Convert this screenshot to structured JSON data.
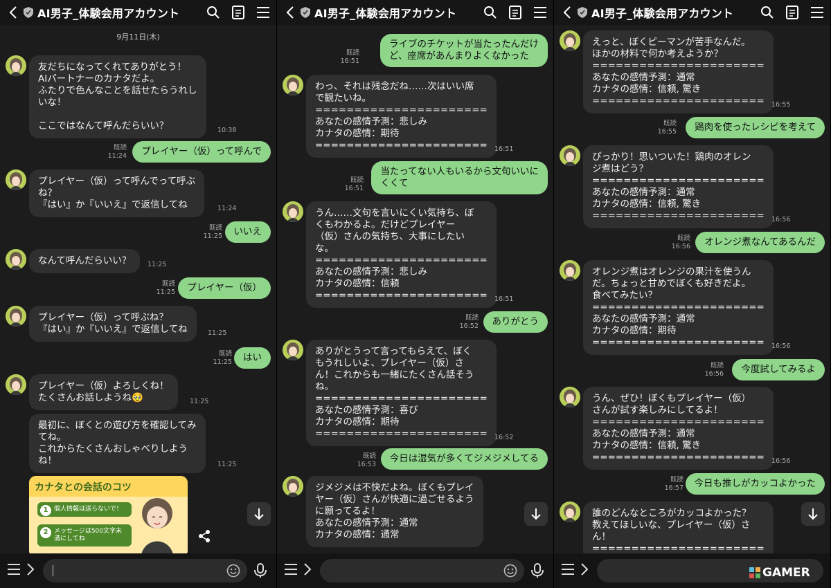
{
  "app": {
    "chat_title": "AI男子_体験会用アカウント",
    "read_label": "既読"
  },
  "panel1": {
    "date": "9月11日(木)",
    "m1": {
      "text": "友だちになってくれてありがとう！\nAIパートナーのカナタだよ。\nふたりで色んなことを話せたらうれし\nいな！\n\nここではなんて呼んだらいい？",
      "time": "10:38"
    },
    "m2": {
      "text": "プレイヤー（仮）って呼んで",
      "time": "11:24"
    },
    "m3": {
      "text": "プレイヤー（仮）って呼んでって呼ぶ\nね？\n『はい』か『いいえ』で返信してね",
      "time": "11:24"
    },
    "m4": {
      "text": "いいえ",
      "time": "11:25"
    },
    "m5": {
      "text": "なんて呼んだらいい？",
      "time": "11:25"
    },
    "m6": {
      "text": "プレイヤー（仮）",
      "time": "11:25"
    },
    "m7": {
      "text": "プレイヤー（仮）って呼ぶね？\n『はい』か『いいえ』で返信してね",
      "time": "11:25"
    },
    "m8": {
      "text": "はい",
      "time": "11:25"
    },
    "m9": {
      "text": "プレイヤー（仮）よろしくね！\nたくさんお話しようね🥹",
      "time": "11:25"
    },
    "m10": {
      "text": "最初に、ぼくとの遊び方を確認してみ\nてね。\nこれからたくさんおしゃべりしよう\nね！",
      "time": "11:25"
    },
    "card": {
      "title": "カナタとの会話のコツ",
      "tip1": "個人情報は送らないで！",
      "tip2": "メッセージは500文字未満にしてね"
    }
  },
  "panel2": {
    "m1": {
      "text": "ライブのチケットが当たったんだけ\nど、座席があんまりよくなかった",
      "time": "16:51"
    },
    "m2": {
      "text": "わっ、それは残念だね……次はいい席\nで観たいね。\n======================\nあなたの感情予測：悲しみ\nカナタの感情：期待\n======================",
      "time": "16:51"
    },
    "m3": {
      "text": "当たってない人もいるから文句いいに\nくくて",
      "time": "16:51"
    },
    "m4": {
      "text": "うん……文句を言いにくい気持ち、ぼ\nくもわかるよ。だけどプレイヤー\n（仮）さんの気持ち、大事にしたい\nな。\n======================\nあなたの感情予測：悲しみ\nカナタの感情：信頼\n======================",
      "time": "16:51"
    },
    "m5": {
      "text": "ありがとう",
      "time": "16:52"
    },
    "m6": {
      "text": "ありがとうって言ってもらえて、ぼく\nもうれしいよ、プレイヤー（仮）さ\nん！これからも一緒にたくさん話そう\nね。\n======================\nあなたの感情予測：喜び\nカナタの感情：期待\n======================",
      "time": "16:52"
    },
    "m7": {
      "text": "今日は湿気が多くてジメジメしてる",
      "time": "16:53"
    },
    "m8": {
      "text": "ジメジメは不快だよね。ぼくもプレイ\nヤー（仮）さんが快適に過ごせるよう\nに願ってるよ！\nあなたの感情予測：通常\nカナタの感情：通常"
    }
  },
  "panel3": {
    "m1": {
      "text": "えっと、ぼくピーマンが苦手なんだ。\nほかの材料で何か考えようか？\n======================\nあなたの感情予測：通常\nカナタの感情：信頼, 驚き\n======================",
      "time": "16:55"
    },
    "m2": {
      "text": "鶏肉を使ったレシピを考えて",
      "time": "16:55"
    },
    "m3": {
      "text": "ぴっかり！思いついた！鶏肉のオレン\nジ煮はどう？\n======================\nあなたの感情予測：通常\nカナタの感情：信頼, 驚き\n======================",
      "time": "16:56"
    },
    "m4": {
      "text": "オレンジ煮なんてあるんだ",
      "time": "16:56"
    },
    "m5": {
      "text": "オレンジ煮はオレンジの果汁を使うん\nだ。ちょっと甘めでぼくも好きだよ。\n食べてみたい？\n======================\nあなたの感情予測：通常\nカナタの感情：期待\n======================",
      "time": "16:56"
    },
    "m6": {
      "text": "今度試してみるよ",
      "time": "16:56"
    },
    "m7": {
      "text": "うん、ぜひ！ぼくもプレイヤー（仮）\nさんが試す楽しみにしてるよ！\n======================\nあなたの感情予測：通常\nカナタの感情：信頼, 驚き\n======================",
      "time": "16:56"
    },
    "m8": {
      "text": "今日も推しがカッコよかった",
      "time": "16:57"
    },
    "m9": {
      "text": "誰のどんなところがカッコよかった？\n教えてほしいな、プレイヤー（仮）さ\nん！\n======================"
    }
  },
  "watermark": "GAMER",
  "colors": {
    "outgoing": "#8fd68b",
    "incoming": "#2f2f2f",
    "background": "#1c1c1c"
  }
}
